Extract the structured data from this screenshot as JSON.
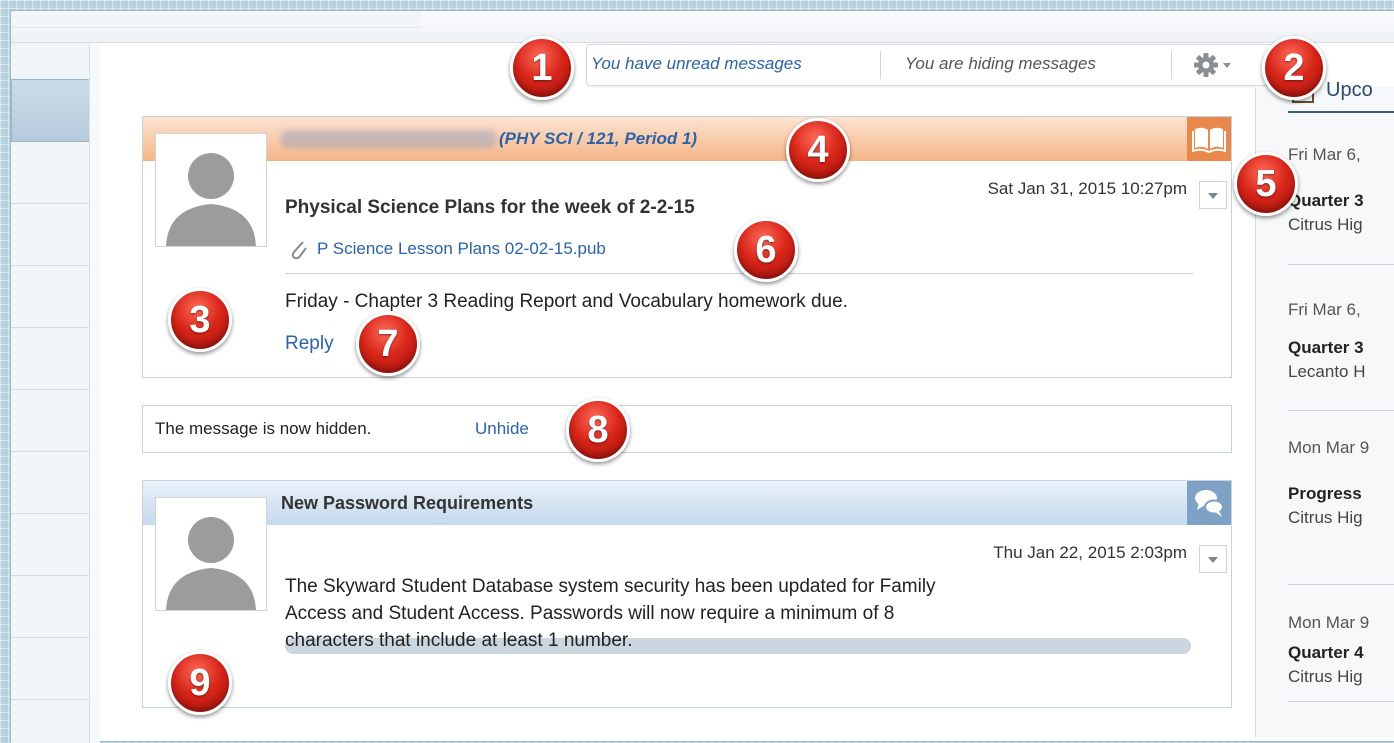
{
  "header": {
    "unread_link": "You have unread messages",
    "hiding_link": "You are hiding messages"
  },
  "message1": {
    "sender_class": "(PHY SCI / 121, Period 1)",
    "timestamp": "Sat Jan 31, 2015 10:27pm",
    "subject": "Physical Science Plans for the week of 2-2-15",
    "attachment": "P Science Lesson Plans 02-02-15.pub",
    "body": "Friday - Chapter 3 Reading Report and Vocabulary homework due.",
    "reply_label": "Reply"
  },
  "hidden_notice": {
    "text": "The message is now hidden.",
    "unhide_label": "Unhide"
  },
  "message2": {
    "subject": "New Password Requirements",
    "timestamp": "Thu Jan 22, 2015 2:03pm",
    "body_lines": [
      "The Skyward Student Database system security has been updated for Family",
      "Access and Student Access. Passwords will now require a minimum of 8",
      "characters that include at least 1 number."
    ]
  },
  "upcoming": {
    "title": "Upco",
    "items": [
      {
        "date": "Fri Mar 6,",
        "title": "Quarter 3",
        "school": "Citrus Hig"
      },
      {
        "date": "Fri Mar 6,",
        "title": "Quarter 3",
        "school": "Lecanto H"
      },
      {
        "date": "Mon Mar 9",
        "title": "Progress",
        "school": "Citrus Hig"
      },
      {
        "date": "Mon Mar 9",
        "title": "Quarter 4",
        "school": "Citrus Hig"
      }
    ]
  },
  "markers": [
    "1",
    "2",
    "3",
    "4",
    "5",
    "6",
    "7",
    "8",
    "9"
  ],
  "colors": {
    "accent_orange": "#f0a067",
    "accent_blue": "#c9ddef",
    "link_blue": "#2a63a8",
    "marker_red": "#d8261a"
  }
}
